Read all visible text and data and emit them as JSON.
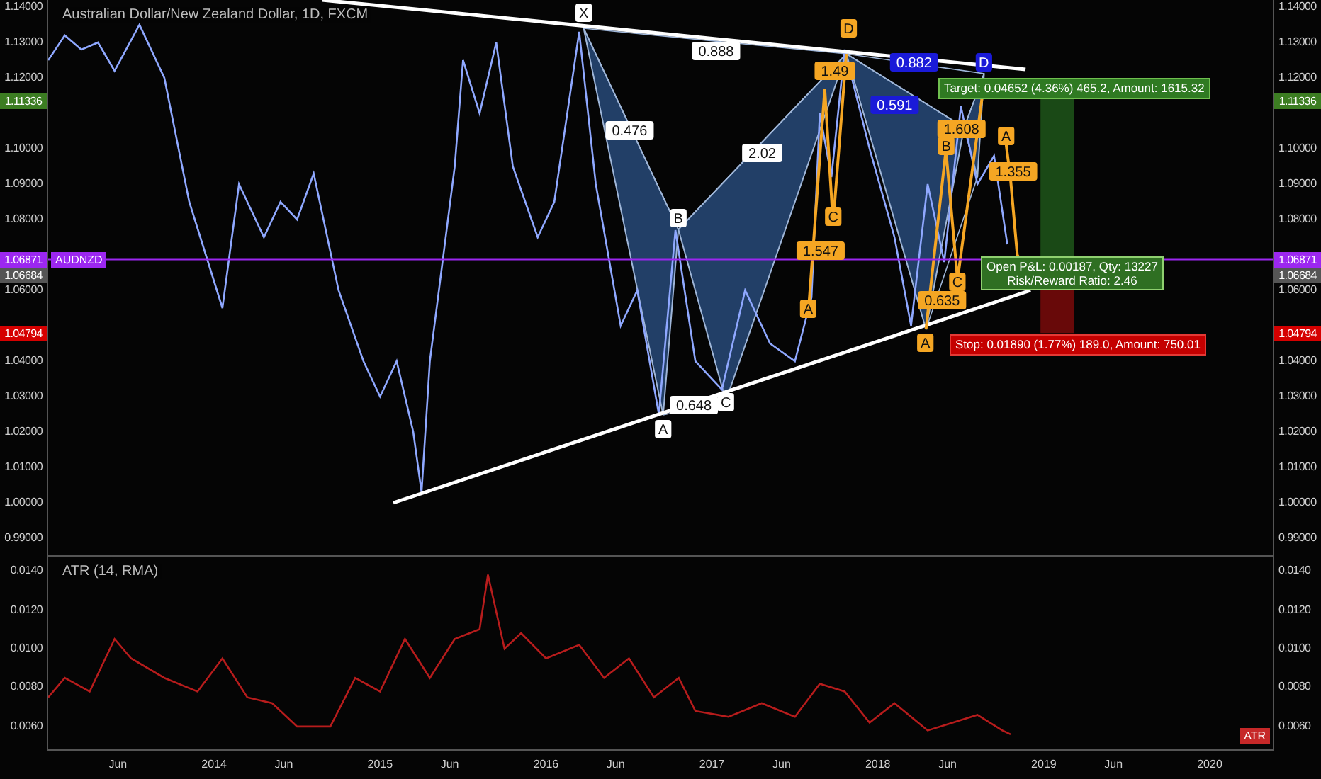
{
  "title": "Australian Dollar/New Zealand Dollar, 1D, FXCM",
  "price_pane": {
    "chart_data": {
      "type": "line",
      "xlim": [
        2013.0,
        2020.38
      ],
      "ylim": [
        0.9848,
        1.142
      ],
      "x": [
        2013.0,
        2013.1,
        2013.2,
        2013.3,
        2013.4,
        2013.55,
        2013.7,
        2013.85,
        2013.95,
        2014.05,
        2014.15,
        2014.3,
        2014.4,
        2014.5,
        2014.6,
        2014.75,
        2014.9,
        2015.0,
        2015.1,
        2015.2,
        2015.25,
        2015.3,
        2015.45,
        2015.5,
        2015.6,
        2015.7,
        2015.8,
        2015.95,
        2016.05,
        2016.2,
        2016.3,
        2016.45,
        2016.55,
        2016.68,
        2016.78,
        2016.9,
        2017.06,
        2017.2,
        2017.35,
        2017.5,
        2017.6,
        2017.65,
        2017.72,
        2017.8,
        2017.95,
        2018.1,
        2018.2,
        2018.3,
        2018.4,
        2018.5,
        2018.6,
        2018.7,
        2018.78
      ],
      "series": [
        {
          "name": "AUDNZD",
          "color": "#8fa8ff",
          "values": [
            1.125,
            1.132,
            1.128,
            1.13,
            1.122,
            1.135,
            1.12,
            1.085,
            1.07,
            1.055,
            1.09,
            1.075,
            1.085,
            1.08,
            1.093,
            1.06,
            1.04,
            1.03,
            1.04,
            1.02,
            1.003,
            1.04,
            1.095,
            1.125,
            1.11,
            1.13,
            1.095,
            1.075,
            1.085,
            1.133,
            1.09,
            1.05,
            1.06,
            1.025,
            1.077,
            1.04,
            1.032,
            1.06,
            1.045,
            1.04,
            1.058,
            1.11,
            1.092,
            1.128,
            1.1,
            1.075,
            1.05,
            1.09,
            1.068,
            1.112,
            1.09,
            1.098,
            1.073
          ]
        }
      ],
      "ref_lines": [
        {
          "axis": "y",
          "value": 1.06871,
          "color": "#9c27f0"
        }
      ],
      "yticks": [
        {
          "value": 1.14,
          "label": "1.14000"
        },
        {
          "value": 1.13,
          "label": "1.13000"
        },
        {
          "value": 1.12,
          "label": "1.12000"
        },
        {
          "value": 1.1,
          "label": "1.10000"
        },
        {
          "value": 1.09,
          "label": "1.09000"
        },
        {
          "value": 1.08,
          "label": "1.08000"
        },
        {
          "value": 1.06,
          "label": "1.06000"
        },
        {
          "value": 1.04,
          "label": "1.04000"
        },
        {
          "value": 1.03,
          "label": "1.03000"
        },
        {
          "value": 1.02,
          "label": "1.02000"
        },
        {
          "value": 1.01,
          "label": "1.01000"
        },
        {
          "value": 1.0,
          "label": "1.00000"
        },
        {
          "value": 0.99,
          "label": "0.99000"
        }
      ]
    },
    "pattern_labels": [
      {
        "text": "X",
        "color": "#ffffff"
      },
      {
        "text": "0.888",
        "color": "#ffffff"
      },
      {
        "text": "0.476",
        "color": "#ffffff"
      },
      {
        "text": "2.02",
        "color": "#ffffff"
      },
      {
        "text": "B",
        "color": "#ffffff"
      },
      {
        "text": "0.648",
        "color": "#ffffff"
      },
      {
        "text": "C",
        "color": "#ffffff"
      },
      {
        "text": "A",
        "color": "#ffffff"
      },
      {
        "text": "D",
        "color": "#f5a623"
      },
      {
        "text": "1.49",
        "color": "#f5a623"
      },
      {
        "text": "C",
        "color": "#f5a623"
      },
      {
        "text": "1.547",
        "color": "#f5a623"
      },
      {
        "text": "A",
        "color": "#f5a623"
      },
      {
        "text": "0.591",
        "color": "#1a1ad8"
      },
      {
        "text": "0.882",
        "color": "#1a1ad8"
      },
      {
        "text": "D",
        "color": "#1a1ad8"
      },
      {
        "text": "1.608",
        "color": "#f5a623"
      },
      {
        "text": "B",
        "color": "#f5a623"
      },
      {
        "text": "C",
        "color": "#f5a623"
      },
      {
        "text": "0.635",
        "color": "#f5a623"
      },
      {
        "text": "A",
        "color": "#f5a623"
      },
      {
        "text": "A",
        "color": "#f5a623"
      },
      {
        "text": "1.355",
        "color": "#f5a623"
      }
    ],
    "position": {
      "target_label": "Target: 0.04652 (4.36%) 465.2, Amount: 1615.32",
      "pnl_label": "Open P&L: 0.00187, Qty: 13227",
      "ratio_label": "Risk/Reward Ratio: 2.46",
      "stop_label": "Stop: 0.01890 (1.77%) 189.0, Amount: 750.01"
    },
    "left_tags": [
      {
        "text": "1.11336",
        "color": "#3c7d22"
      },
      {
        "text": "1.06871",
        "color": "#9c27f0"
      },
      {
        "text": "1.06684",
        "color": "#555555"
      },
      {
        "text": "1.04794",
        "color": "#d50000"
      }
    ],
    "right_axis": {
      "ticks": [
        "1.14000",
        "1.13000",
        "1.12000",
        "1.10000",
        "1.09000",
        "1.08000",
        "1.06000",
        "1.04000",
        "1.03000",
        "1.02000",
        "1.01000",
        "1.00000",
        "0.99000"
      ]
    },
    "right_tags": [
      {
        "text": "1.11336",
        "color": "#3c7d22"
      },
      {
        "text": "1.06871",
        "color": "#9c27f0"
      },
      {
        "text": "1.06684",
        "color": "#555555"
      },
      {
        "text": "1.04794",
        "color": "#d50000"
      }
    ]
  },
  "atr_pane": {
    "chart_data": {
      "type": "line",
      "title": "ATR (14, RMA)",
      "xlim": [
        2013.0,
        2020.38
      ],
      "ylim": [
        0.00476,
        0.01473
      ],
      "x": [
        2013.0,
        2013.1,
        2013.25,
        2013.4,
        2013.5,
        2013.7,
        2013.9,
        2014.05,
        2014.2,
        2014.35,
        2014.5,
        2014.7,
        2014.85,
        2015.0,
        2015.15,
        2015.3,
        2015.45,
        2015.6,
        2015.65,
        2015.75,
        2015.85,
        2016.0,
        2016.2,
        2016.35,
        2016.5,
        2016.65,
        2016.8,
        2016.9,
        2017.1,
        2017.3,
        2017.5,
        2017.65,
        2017.8,
        2017.95,
        2018.1,
        2018.3,
        2018.45,
        2018.6,
        2018.75,
        2018.8
      ],
      "series": [
        {
          "name": "ATR",
          "color": "#b71c1c",
          "values": [
            0.0075,
            0.0085,
            0.0078,
            0.0105,
            0.0095,
            0.0085,
            0.0078,
            0.0095,
            0.0075,
            0.0072,
            0.006,
            0.006,
            0.0085,
            0.0078,
            0.0105,
            0.0085,
            0.0105,
            0.011,
            0.0138,
            0.01,
            0.0108,
            0.0095,
            0.0102,
            0.0085,
            0.0095,
            0.0075,
            0.0085,
            0.0068,
            0.0065,
            0.0072,
            0.0065,
            0.0082,
            0.0078,
            0.0062,
            0.0072,
            0.0058,
            0.0062,
            0.0066,
            0.0058,
            0.0056
          ]
        }
      ],
      "yticks": [
        {
          "value": 0.014,
          "label": "0.0140"
        },
        {
          "value": 0.012,
          "label": "0.0120"
        },
        {
          "value": 0.01,
          "label": "0.0100"
        },
        {
          "value": 0.008,
          "label": "0.0080"
        },
        {
          "value": 0.006,
          "label": "0.0060"
        }
      ],
      "xticks": [
        {
          "value": 2013.42,
          "label": "Jun"
        },
        {
          "value": 2014,
          "label": "2014"
        },
        {
          "value": 2014.42,
          "label": "Jun"
        },
        {
          "value": 2015,
          "label": "2015"
        },
        {
          "value": 2015.42,
          "label": "Jun"
        },
        {
          "value": 2016,
          "label": "2016"
        },
        {
          "value": 2016.42,
          "label": "Jun"
        },
        {
          "value": 2017,
          "label": "2017"
        },
        {
          "value": 2017.42,
          "label": "Jun"
        },
        {
          "value": 2018,
          "label": "2018"
        },
        {
          "value": 2018.42,
          "label": "Jun"
        },
        {
          "value": 2019,
          "label": "2019"
        },
        {
          "value": 2019.42,
          "label": "Jun"
        },
        {
          "value": 2020,
          "label": "2020"
        }
      ]
    },
    "right_axis": {
      "ticks": [
        "0.0140",
        "0.0120",
        "0.0100",
        "0.0080",
        "0.0060"
      ]
    },
    "indicator_tag": {
      "color": "#c62828"
    }
  }
}
